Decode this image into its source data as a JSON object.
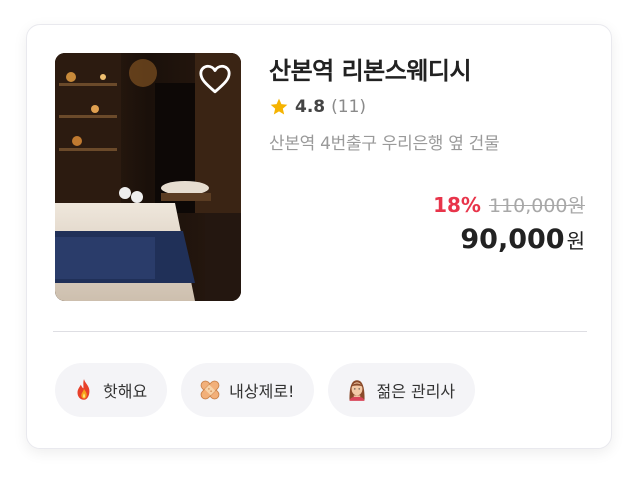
{
  "listing": {
    "title": "산본역 리본스웨디시",
    "rating": "4.8",
    "review_count": "(11)",
    "address": "산본역 4번출구 우리은행 옆 건물",
    "discount_rate": "18%",
    "original_price": "110,000원",
    "final_price": "90,000",
    "currency": "원",
    "favorited": false
  },
  "tags": [
    {
      "label": "핫해요",
      "icon": "fire-icon"
    },
    {
      "label": "내상제로!",
      "icon": "bandage-icon"
    },
    {
      "label": "젊은 관리사",
      "icon": "woman-icon"
    }
  ],
  "colors": {
    "discount": "#e8344a",
    "star": "#f5b301",
    "tag_bg": "#f4f4f7"
  }
}
